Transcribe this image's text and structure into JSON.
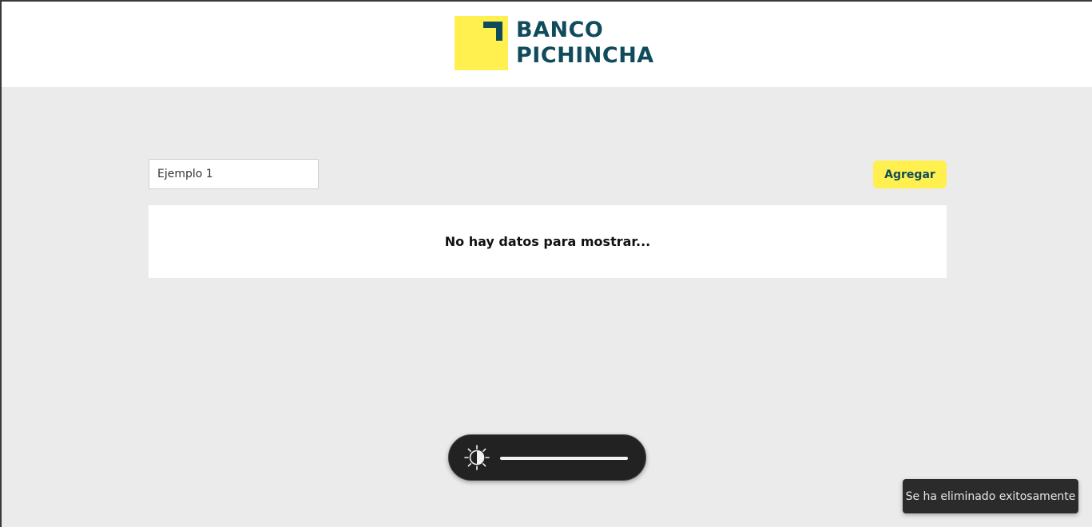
{
  "brand": {
    "name_line1": "BANCO",
    "name_line2": "PICHINCHA",
    "logo_icon": "banco-pichincha-logo-icon",
    "colors": {
      "yellow": "#fff04f",
      "teal": "#0f4b5b"
    }
  },
  "toolbar": {
    "search_value": "Ejemplo 1",
    "add_label": "Agregar"
  },
  "table": {
    "empty_message": "No hay datos para mostrar..."
  },
  "brightness_osd": {
    "icon": "brightness-icon",
    "level": 1.0
  },
  "toast": {
    "message": "Se ha eliminado exitosamente"
  }
}
